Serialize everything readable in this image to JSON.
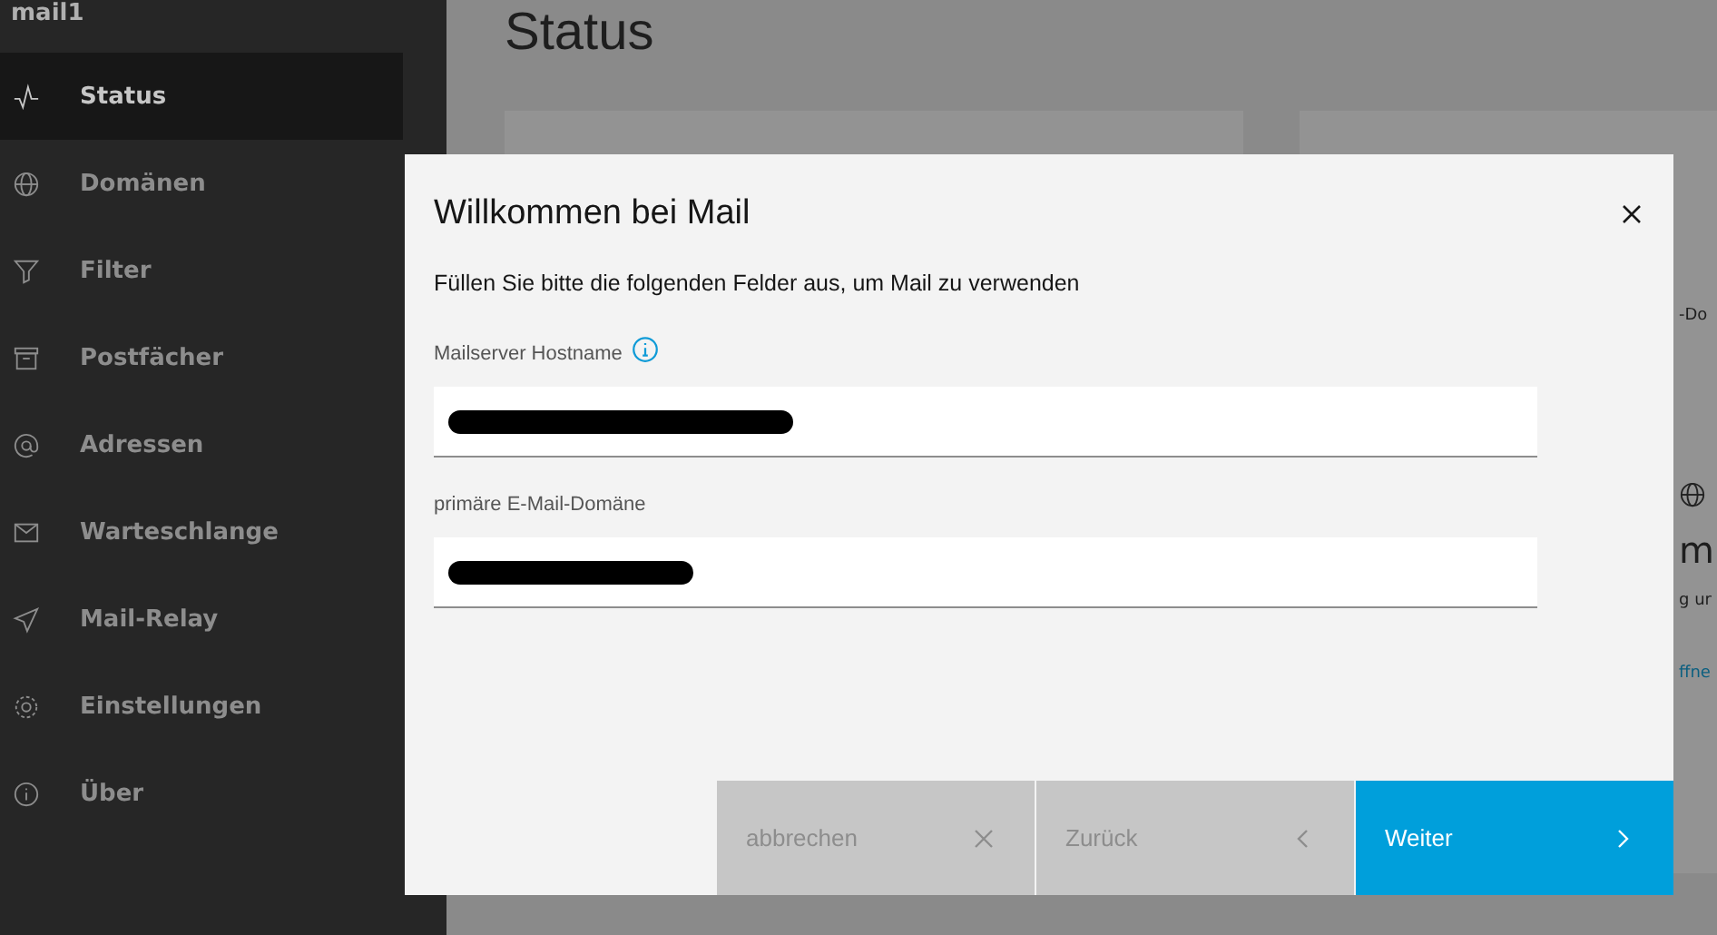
{
  "sidebar": {
    "title": "mail1",
    "items": [
      {
        "label": "Status",
        "selected": true
      },
      {
        "label": "Domänen",
        "selected": false
      },
      {
        "label": "Filter",
        "selected": false
      },
      {
        "label": "Postfächer",
        "selected": false
      },
      {
        "label": "Adressen",
        "selected": false
      },
      {
        "label": "Warteschlange",
        "selected": false
      },
      {
        "label": "Mail-Relay",
        "selected": false
      },
      {
        "label": "Einstellungen",
        "selected": false
      },
      {
        "label": "Über",
        "selected": false
      }
    ]
  },
  "main": {
    "title": "Status",
    "right_card": {
      "text_1": "-Do",
      "heading": "m",
      "text_2": "g ur",
      "link": "ffne"
    }
  },
  "dialog": {
    "title": "Willkommen bei Mail",
    "description": "Füllen Sie bitte die folgenden Felder aus, um Mail zu verwenden",
    "fields": [
      {
        "label": "Mailserver Hostname",
        "info": true,
        "redacted": true
      },
      {
        "label": "primäre E-Mail-Domäne",
        "info": false,
        "redacted": true
      }
    ],
    "buttons": [
      {
        "label": "abbrechen",
        "kind": "cancel",
        "disabled": true
      },
      {
        "label": "Zurück",
        "kind": "back",
        "disabled": true
      },
      {
        "label": "Weiter",
        "kind": "next",
        "disabled": false
      }
    ]
  }
}
